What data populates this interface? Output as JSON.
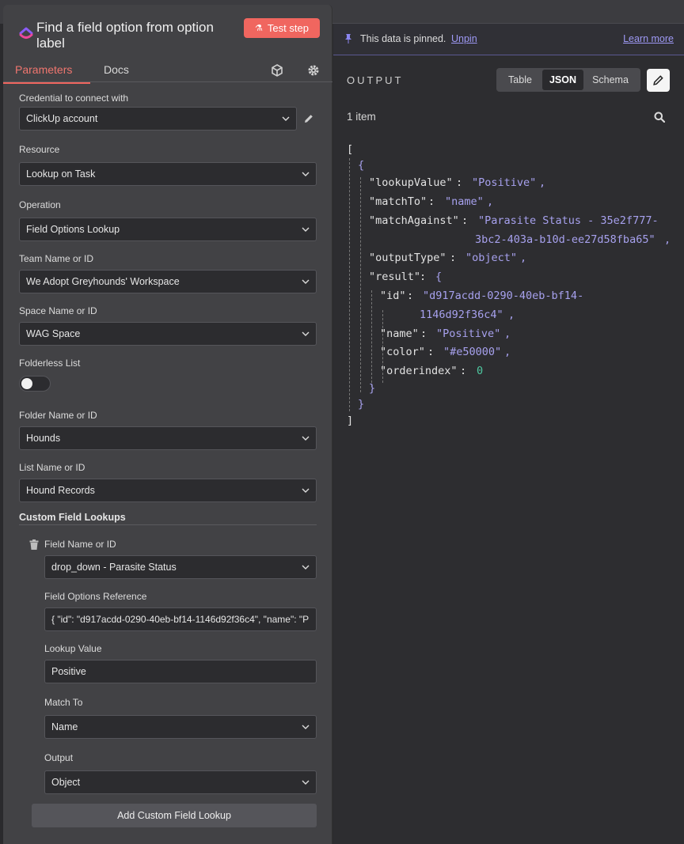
{
  "node": {
    "title": "Find a field option from option label",
    "test_button": "Test step",
    "tabs": {
      "parameters": "Parameters",
      "docs": "Docs"
    }
  },
  "form": {
    "credential": {
      "label": "Credential to connect with",
      "value": "ClickUp account"
    },
    "resource": {
      "label": "Resource",
      "value": "Lookup on Task"
    },
    "operation": {
      "label": "Operation",
      "value": "Field Options Lookup"
    },
    "team": {
      "label": "Team Name or ID",
      "value": "We Adopt Greyhounds' Workspace"
    },
    "space": {
      "label": "Space Name or ID",
      "value": "WAG Space"
    },
    "folderless": {
      "label": "Folderless List",
      "enabled": false
    },
    "folder": {
      "label": "Folder Name or ID",
      "value": "Hounds"
    },
    "list": {
      "label": "List Name or ID",
      "value": "Hound Records"
    },
    "custom": {
      "title": "Custom Field Lookups",
      "field": {
        "label": "Field Name or ID",
        "value": "drop_down - Parasite Status"
      },
      "options_ref": {
        "label": "Field Options Reference",
        "value": "{  \"id\": \"d917acdd-0290-40eb-bf14-1146d92f36c4\",  \"name\": \"P"
      },
      "lookup": {
        "label": "Lookup Value",
        "value": "Positive"
      },
      "match": {
        "label": "Match To",
        "value": "Name"
      },
      "output": {
        "label": "Output",
        "value": "Object"
      },
      "add_button": "Add Custom Field Lookup"
    }
  },
  "output": {
    "pin_message": "This data is pinned.",
    "unpin": "Unpin",
    "learn_more": "Learn more",
    "label": "OUTPUT",
    "views": [
      "Table",
      "JSON",
      "Schema"
    ],
    "active_view": "JSON",
    "count": "1 item",
    "json": {
      "open_bracket": "[",
      "open_brace": "{",
      "lookupValue_key": "\"lookupValue\"",
      "lookupValue_val": "\"Positive\"",
      "matchTo_key": "\"matchTo\"",
      "matchTo_val": "\"name\"",
      "matchAgainst_key": "\"matchAgainst\"",
      "matchAgainst_val1": "\"Parasite Status - 35e2f777-",
      "matchAgainst_val2": "3bc2-403a-b10d-ee27d58fba65\"",
      "outputType_key": "\"outputType\"",
      "outputType_val": "\"object\"",
      "result_key": "\"result\"",
      "id_key": "\"id\"",
      "id_val1": "\"d917acdd-0290-40eb-bf14-",
      "id_val2": "1146d92f36c4\"",
      "name_key": "\"name\"",
      "name_val": "\"Positive\"",
      "color_key": "\"color\"",
      "color_val": "\"#e50000\"",
      "orderindex_key": "\"orderindex\"",
      "orderindex_val": "0",
      "close_inner": "}",
      "close_brace": "}",
      "close_bracket": "]"
    }
  },
  "colors": {
    "accent": "#f0665f",
    "link": "#9e99f5",
    "string": "#a7a1ee",
    "number": "#4ec7a0"
  }
}
